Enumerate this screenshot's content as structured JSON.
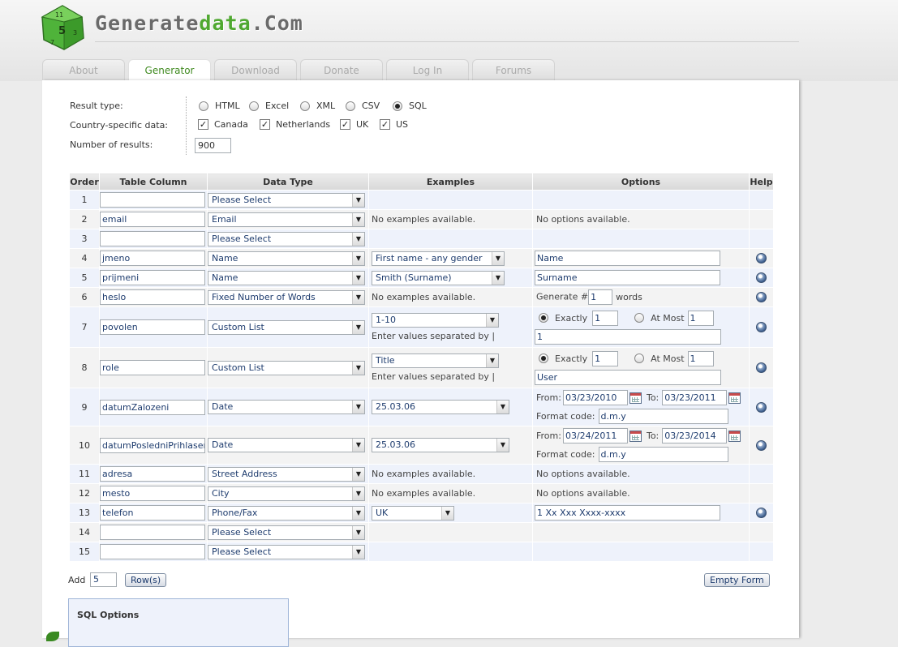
{
  "site": {
    "logo_prefix": "Generate",
    "logo_data": "data",
    "logo_suffix": ".Com",
    "die_numbers": [
      "5",
      "11",
      "7",
      "3"
    ]
  },
  "tabs": [
    {
      "label": "About",
      "active": false
    },
    {
      "label": "Generator",
      "active": true
    },
    {
      "label": "Download",
      "active": false
    },
    {
      "label": "Donate",
      "active": false
    },
    {
      "label": "Log In",
      "active": false
    },
    {
      "label": "Forums",
      "active": false
    }
  ],
  "form": {
    "result_type_label": "Result type:",
    "result_types": [
      {
        "label": "HTML",
        "checked": false
      },
      {
        "label": "Excel",
        "checked": false
      },
      {
        "label": "XML",
        "checked": false
      },
      {
        "label": "CSV",
        "checked": false
      },
      {
        "label": "SQL",
        "checked": true
      }
    ],
    "country_label": "Country-specific data:",
    "countries": [
      {
        "label": "Canada",
        "checked": true
      },
      {
        "label": "Netherlands",
        "checked": true
      },
      {
        "label": "UK",
        "checked": true
      },
      {
        "label": "US",
        "checked": true
      }
    ],
    "num_results_label": "Number of results:",
    "num_results": "900"
  },
  "table": {
    "headers": [
      "Order",
      "Table Column",
      "Data Type",
      "Examples",
      "Options",
      "Help"
    ],
    "rows": [
      {
        "order": "1",
        "column": "",
        "type": "Please Select"
      },
      {
        "order": "2",
        "column": "email",
        "type": "Email",
        "ex_text": "No examples available.",
        "opt_text": "No options available."
      },
      {
        "order": "3",
        "column": "",
        "type": "Please Select"
      },
      {
        "order": "4",
        "column": "jmeno",
        "type": "Name",
        "ex_select": "First name - any gender",
        "opt_input": "Name",
        "help": true
      },
      {
        "order": "5",
        "column": "prijmeni",
        "type": "Name",
        "ex_select": "Smith (Surname)",
        "opt_input": "Surname",
        "help": true
      },
      {
        "order": "6",
        "column": "heslo",
        "type": "Fixed Number of Words",
        "ex_text": "No examples available.",
        "gen_prefix": "Generate #",
        "gen_value": "1",
        "gen_suffix": "words",
        "help": true
      },
      {
        "order": "7",
        "column": "povolen",
        "type": "Custom List",
        "ex_select": "1-10",
        "ex_note": "Enter values separated by |",
        "exactly_label": "Exactly",
        "exactly": "1",
        "atmost_label": "At Most",
        "atmost": "1",
        "list_values": "1",
        "help": true
      },
      {
        "order": "8",
        "column": "role",
        "type": "Custom List",
        "ex_select": "Title",
        "ex_note": "Enter values separated by |",
        "exactly_label": "Exactly",
        "exactly": "1",
        "atmost_label": "At Most",
        "atmost": "1",
        "list_values": "User",
        "help": true
      },
      {
        "order": "9",
        "column": "datumZalozeni",
        "type": "Date",
        "ex_select": "25.03.06",
        "from_label": "From:",
        "from": "03/23/2010",
        "to_label": "To:",
        "to": "03/23/2011",
        "format_label": "Format code:",
        "format": "d.m.y",
        "help": true
      },
      {
        "order": "10",
        "column": "datumPosledniPrihlaseni",
        "type": "Date",
        "ex_select": "25.03.06",
        "from_label": "From:",
        "from": "03/24/2011",
        "to_label": "To:",
        "to": "03/23/2014",
        "format_label": "Format code:",
        "format": "d.m.y",
        "help": true
      },
      {
        "order": "11",
        "column": "adresa",
        "type": "Street Address",
        "ex_text": "No examples available.",
        "opt_text": "No options available."
      },
      {
        "order": "12",
        "column": "mesto",
        "type": "City",
        "ex_text": "No examples available.",
        "opt_text": "No options available."
      },
      {
        "order": "13",
        "column": "telefon",
        "type": "Phone/Fax",
        "ex_select": "UK",
        "opt_input": "1 Xx Xxx Xxxx-xxxx",
        "help": true
      },
      {
        "order": "14",
        "column": "",
        "type": "Please Select"
      },
      {
        "order": "15",
        "column": "",
        "type": "Please Select"
      }
    ]
  },
  "footer": {
    "add_label": "Add",
    "add_count": "5",
    "rows_button": "Row(s)",
    "empty_button": "Empty Form"
  },
  "sql_options": {
    "title": "SQL Options"
  }
}
